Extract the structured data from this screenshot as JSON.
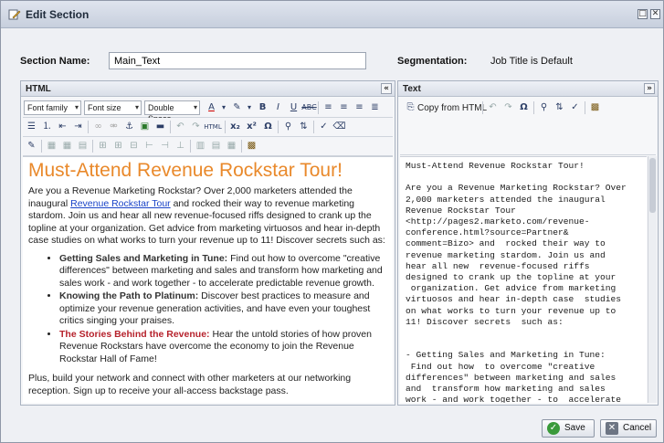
{
  "window": {
    "title": "Edit Section"
  },
  "form": {
    "section_name_label": "Section Name:",
    "section_name_value": "Main_Text",
    "segmentation_label": "Segmentation:",
    "segmentation_value": "Job Title is Default"
  },
  "html_panel": {
    "title": "HTML",
    "font_family": "Font family",
    "font_size": "Font size",
    "line_spacing": "Double Space",
    "content": {
      "heading": "Must-Attend Revenue Rockstar Tour!",
      "intro_before_link": "Are you a Revenue Marketing Rockstar? Over 2,000 marketers attended the inaugural ",
      "intro_link": "Revenue Rockstar Tour",
      "intro_after_link": " and rocked their way to revenue marketing stardom. Join us and hear all new revenue-focused riffs designed to crank up the topline at your organization. Get advice from marketing virtuosos and hear in-depth case studies on what works to turn your revenue up to 11! Discover secrets such as:",
      "bullets": [
        {
          "title": "Getting Sales and Marketing in Tune:",
          "text": " Find out how to overcome \"creative differences\" between marketing and sales and transform how marketing and sales work - and work together - to accelerate predictable revenue growth."
        },
        {
          "title": "Knowing the Path to Platinum:",
          "text": " Discover best practices to measure and optimize your revenue generation activities, and have even your toughest critics singing your praises."
        },
        {
          "title": "The Stories Behind the Revenue:",
          "text": " Hear the untold stories of how proven Revenue Rockstars have overcome the economy to join the Revenue Rockstar Hall of Fame!"
        }
      ],
      "closing": "Plus, build your network and connect with other marketers at our networking reception. Sign up to receive your all-access backstage pass."
    }
  },
  "text_panel": {
    "title": "Text",
    "copy_from_html": "Copy from HTML",
    "content": "Must-Attend Revenue Rockstar Tour!\n\nAre you a Revenue Marketing Rockstar? Over\n2,000 marketers attended the inaugural\nRevenue Rockstar Tour\n<http://pages2.marketo.com/revenue-\nconference.html?source=Partner&\ncomment=Bizo> and  rocked their way to\nrevenue marketing stardom. Join us and\nhear all new  revenue-focused riffs\ndesigned to crank up the topline at your\n organization. Get advice from marketing\nvirtuosos and hear in-depth case  studies\non what works to turn your revenue up to\n11! Discover secrets  such as:\n\n\n- Getting Sales and Marketing in Tune:\n Find out how  to overcome \"creative\ndifferences\" between marketing and sales\nand  transform how marketing and sales\nwork - and work together - to  accelerate\npredictable revenue growth.\n- Knowing the Path to Platinum:  Discover"
  },
  "footer": {
    "save_label": "Save",
    "cancel_label": "Cancel"
  },
  "colors": {
    "heading_orange": "#e9892b",
    "link_blue": "#1a44c8",
    "highlight_red": "#b6222c"
  }
}
